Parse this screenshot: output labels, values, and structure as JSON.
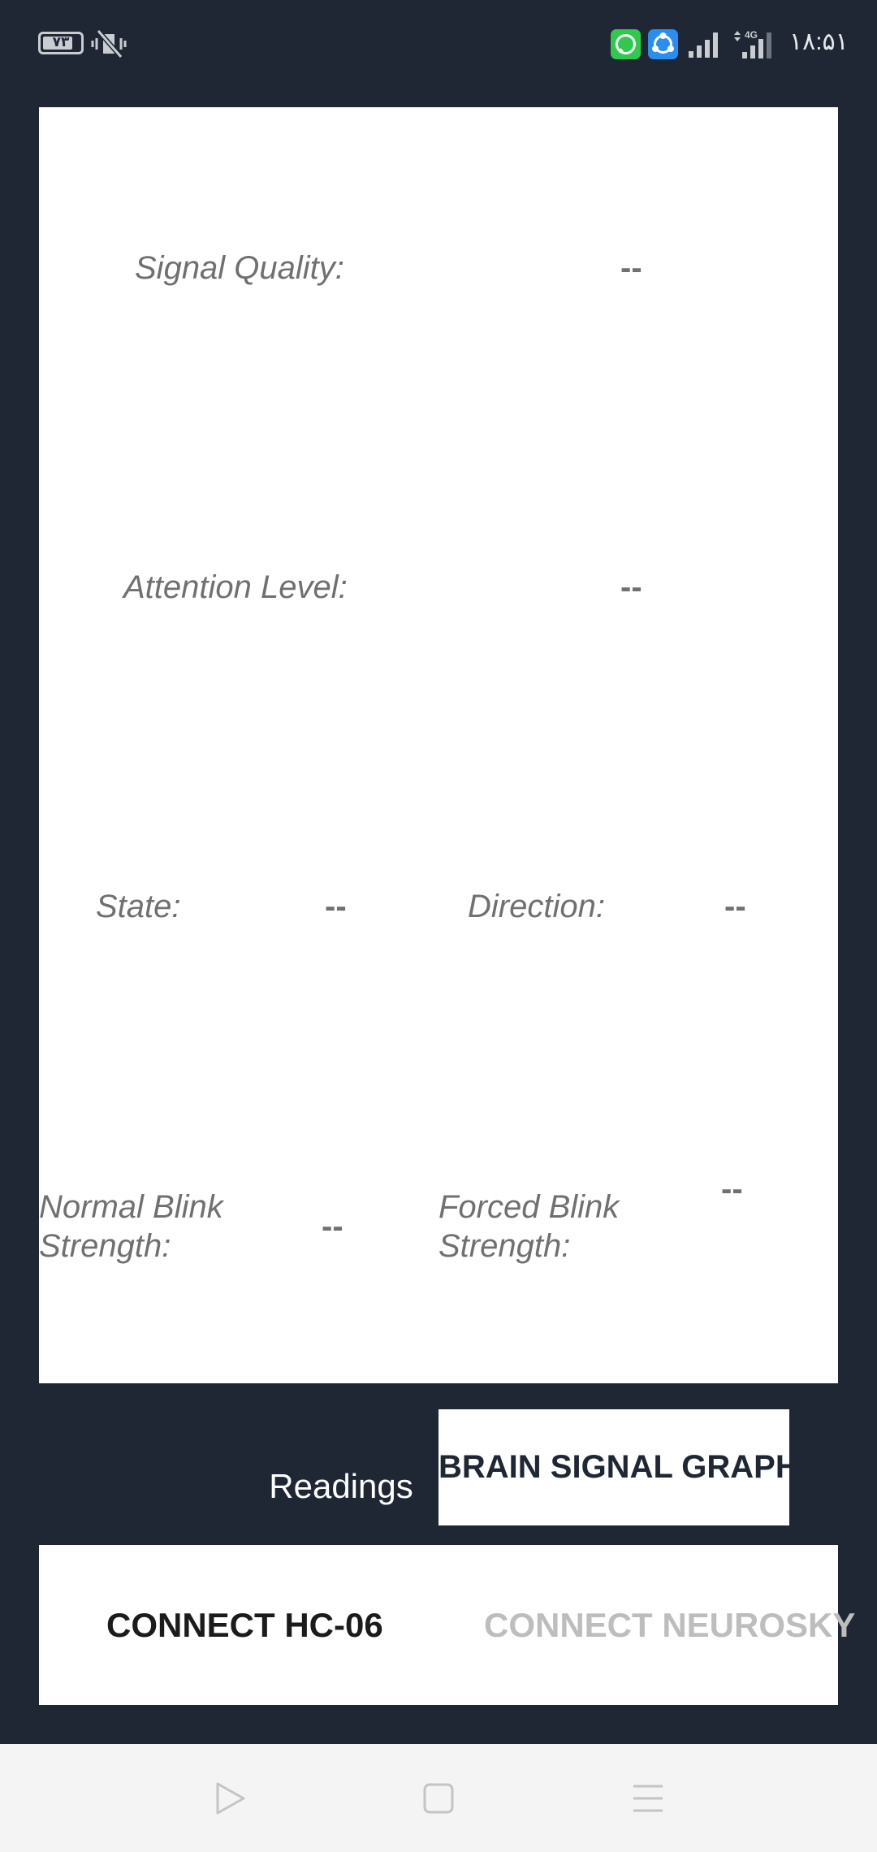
{
  "status_bar": {
    "battery": "۷۳",
    "network": "4G",
    "time": "۱۸:۵۱",
    "icons": [
      "battery-icon",
      "vibrate-off-icon",
      "whatsapp-icon",
      "shareit-icon",
      "signal-icon",
      "signal-4g-icon"
    ]
  },
  "readings": {
    "signal_quality_label": "Signal Quality:",
    "signal_quality_value": "--",
    "attention_label": "Attention Level:",
    "attention_value": "--",
    "state_label": "State:",
    "state_value": "--",
    "direction_label": "Direction:",
    "direction_value": "--",
    "normal_blink_label_1": "Normal Blink",
    "normal_blink_label_2": "Strength:",
    "normal_blink_value": "--",
    "forced_blink_label_1": "Forced Blink",
    "forced_blink_label_2": "Strength:",
    "forced_blink_value": "--"
  },
  "tabs": {
    "readings": "Readings",
    "graph": "BRAIN SIGNAL GRAPH"
  },
  "connect": {
    "hc06": "CONNECT HC-06",
    "neurosky": "CONNECT NEUROSKY"
  },
  "navbar": {
    "icons": [
      "back-triangle-icon",
      "home-square-icon",
      "menu-lines-icon"
    ]
  }
}
